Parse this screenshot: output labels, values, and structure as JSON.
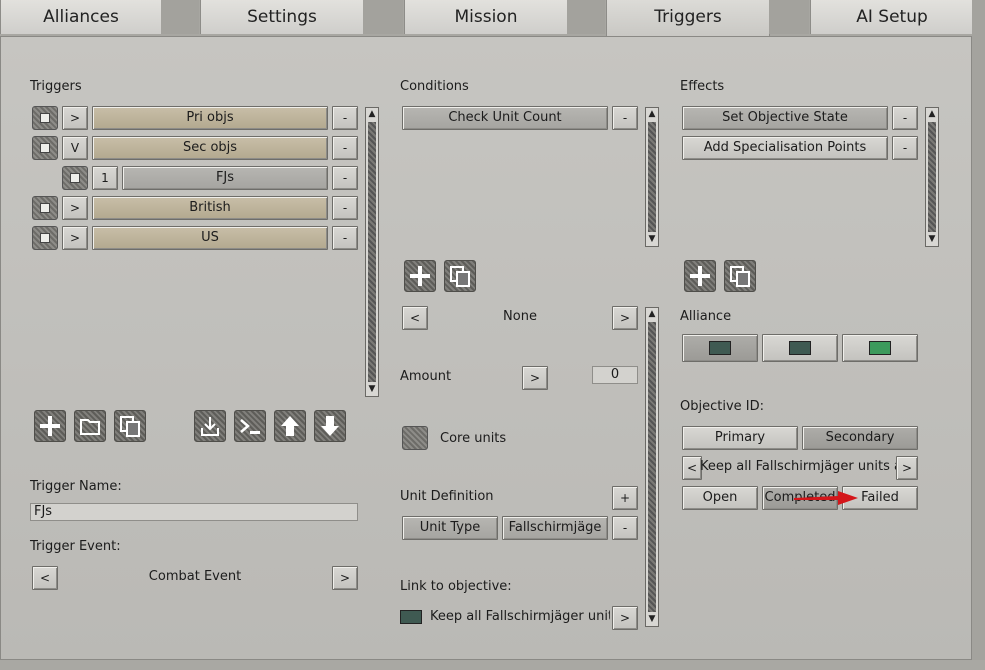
{
  "tabs": [
    {
      "label": "Alliances"
    },
    {
      "label": "Settings"
    },
    {
      "label": "Mission"
    },
    {
      "label": "Triggers"
    },
    {
      "label": "AI Setup"
    }
  ],
  "triggers": {
    "header": "Triggers",
    "rows": [
      {
        "toggle": ">",
        "label": "Pri objs"
      },
      {
        "toggle": "V",
        "label": "Sec objs"
      },
      {
        "toggle": "1",
        "label": "FJs"
      },
      {
        "toggle": ">",
        "label": "British"
      },
      {
        "toggle": ">",
        "label": "US"
      }
    ],
    "remove_label": "-",
    "name_label": "Trigger Name:",
    "name_value": "FJs",
    "event_label": "Trigger Event:",
    "event_value": "Combat Event",
    "prev": "<",
    "next": ">"
  },
  "conditions": {
    "header": "Conditions",
    "items": [
      {
        "label": "Check Unit Count"
      }
    ],
    "remove_label": "-",
    "selector_prev": "<",
    "selector_value": "None",
    "selector_next": ">",
    "amount_label": "Amount",
    "amount_btn": ">",
    "amount_value": "0",
    "core_units_label": "Core units",
    "unit_def_label": "Unit Definition",
    "unit_def_add": "+",
    "unit_type_label": "Unit Type",
    "unit_type_value": "Fallschirmjäge",
    "unit_remove": "-",
    "link_label": "Link to objective:",
    "link_value": "Keep all Fallschirmjäger units alive",
    "link_btn": ">"
  },
  "effects": {
    "header": "Effects",
    "items": [
      {
        "label": "Set Objective State"
      },
      {
        "label": "Add Specialisation Points"
      }
    ],
    "remove_label": "-",
    "alliance_label": "Alliance",
    "alliance_colors": [
      "#3f5a52",
      "#3f5a52",
      "#3c9a5c"
    ],
    "objective_id_label": "Objective ID:",
    "primary_label": "Primary",
    "secondary_label": "Secondary",
    "objective_prev": "<",
    "objective_value": "Keep all Fallschirmjäger units alive",
    "objective_next": ">",
    "open_label": "Open",
    "completed_label": "Completed",
    "failed_label": "Failed"
  },
  "colors": {
    "arrow": "#d4161a"
  }
}
